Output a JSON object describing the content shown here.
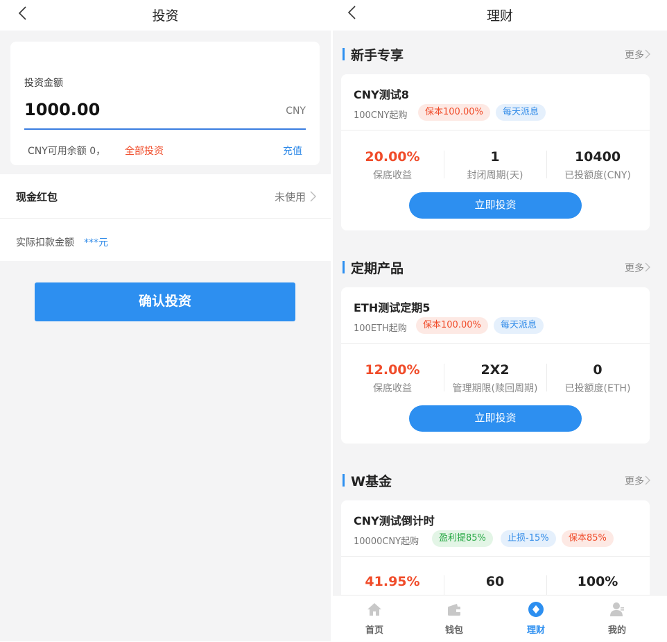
{
  "left": {
    "title": "投资",
    "amount_label": "投资金额",
    "amount_value": "1000.00",
    "amount_unit": "CNY",
    "available_text": "CNY可用余额 0，",
    "all_invest_link": "全部投资",
    "recharge_link": "充值",
    "red_packet_label": "现金红包",
    "red_packet_status": "未使用",
    "deduct_label": "实际扣款金额",
    "deduct_value": "***元",
    "confirm_button": "确认投资"
  },
  "right": {
    "title": "理财",
    "sections": [
      {
        "title": "新手专享",
        "more": "更多",
        "product": {
          "name": "CNY测试8",
          "min": "100CNY起购",
          "tags": [
            {
              "text": "保本100.00%",
              "color": "red"
            },
            {
              "text": "每天派息",
              "color": "blue"
            }
          ],
          "stats": [
            {
              "value": "20.00%",
              "label": "保底收益"
            },
            {
              "value": "1",
              "label": "封闭周期(天)"
            },
            {
              "value": "10400",
              "label": "已投额度(CNY)"
            }
          ],
          "button": "立即投资"
        }
      },
      {
        "title": "定期产品",
        "more": "更多",
        "product": {
          "name": "ETH测试定期5",
          "min": "100ETH起购",
          "tags": [
            {
              "text": "保本100.00%",
              "color": "red"
            },
            {
              "text": "每天派息",
              "color": "blue"
            }
          ],
          "stats": [
            {
              "value": "12.00%",
              "label": "保底收益"
            },
            {
              "value": "2X2",
              "label": "管理期限(赎回周期)"
            },
            {
              "value": "0",
              "label": "已投额度(ETH)"
            }
          ],
          "button": "立即投资"
        }
      },
      {
        "title": "W基金",
        "more": "更多",
        "product": {
          "name": "CNY测试倒计时",
          "min": "10000CNY起购",
          "tags": [
            {
              "text": "盈利提85%",
              "color": "green"
            },
            {
              "text": "止损-15%",
              "color": "blue"
            },
            {
              "text": "保本85%",
              "color": "red"
            }
          ],
          "stats": [
            {
              "value": "41.95%",
              "label": ""
            },
            {
              "value": "60",
              "label": ""
            },
            {
              "value": "100%",
              "label": ""
            }
          ]
        }
      }
    ],
    "tabs": [
      {
        "label": "首页",
        "icon": "home-icon"
      },
      {
        "label": "钱包",
        "icon": "wallet-icon"
      },
      {
        "label": "理财",
        "icon": "finance-icon",
        "active": true
      },
      {
        "label": "我的",
        "icon": "user-icon"
      }
    ]
  },
  "colors": {
    "accent": "#2d8ff0",
    "highlight_red": "#f04c2a",
    "background": "#f4f4f5"
  }
}
